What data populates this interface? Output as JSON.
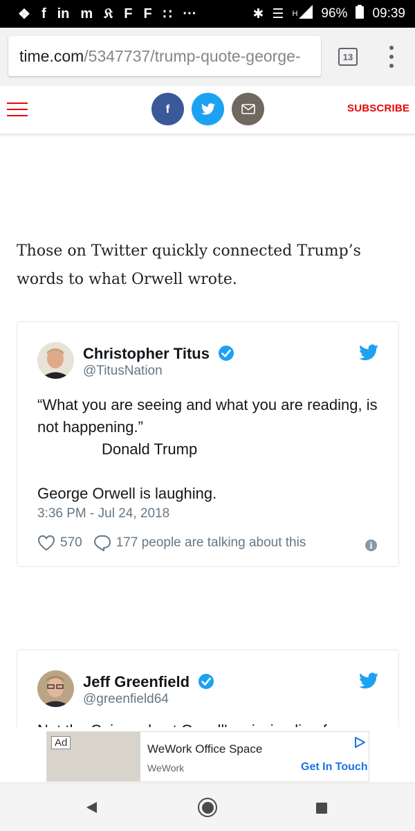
{
  "status_bar": {
    "battery": "96%",
    "time": "09:39",
    "network": "H",
    "notification_icons": [
      "chat-bubble-icon",
      "facebook-icon",
      "linkedin-icon",
      "medium-icon",
      "nytimes-icon",
      "flipboard-icon",
      "flipboard-icon",
      "slack-icon"
    ],
    "overflow": "···"
  },
  "browser": {
    "url_host": "time.com",
    "url_path": "/5347737/trump-quote-george-",
    "tab_count": "13"
  },
  "site_header": {
    "subscribe_label": "SUBSCRIBE",
    "facebook_glyph": "f"
  },
  "article": {
    "paragraph": "Those on Twitter quickly connected Trump’s words to what Orwell wrote."
  },
  "tweets": [
    {
      "name": "Christopher Titus",
      "handle": "@TitusNation",
      "lines": [
        "“What you are seeing and what you are reading, is not happening.”",
        "Donald Trump",
        "George Orwell is laughing."
      ],
      "timestamp": "3:36 PM - Jul 24, 2018",
      "likes": "570",
      "talking": "177 people are talking about this"
    },
    {
      "name": "Jeff Greenfield",
      "handle": "@greenfield64",
      "partial_text": "Not the Cain and not Orwell's missing line fr"
    }
  ],
  "ad": {
    "label": "Ad",
    "title": "WeWork Office Space",
    "sponsor": "WeWork",
    "cta": "Get In Touch"
  },
  "colors": {
    "brand_red": "#e90606",
    "facebook": "#3b5998",
    "twitter": "#1da1f2",
    "mail": "#6e685f",
    "verified": "#1da1f2"
  }
}
